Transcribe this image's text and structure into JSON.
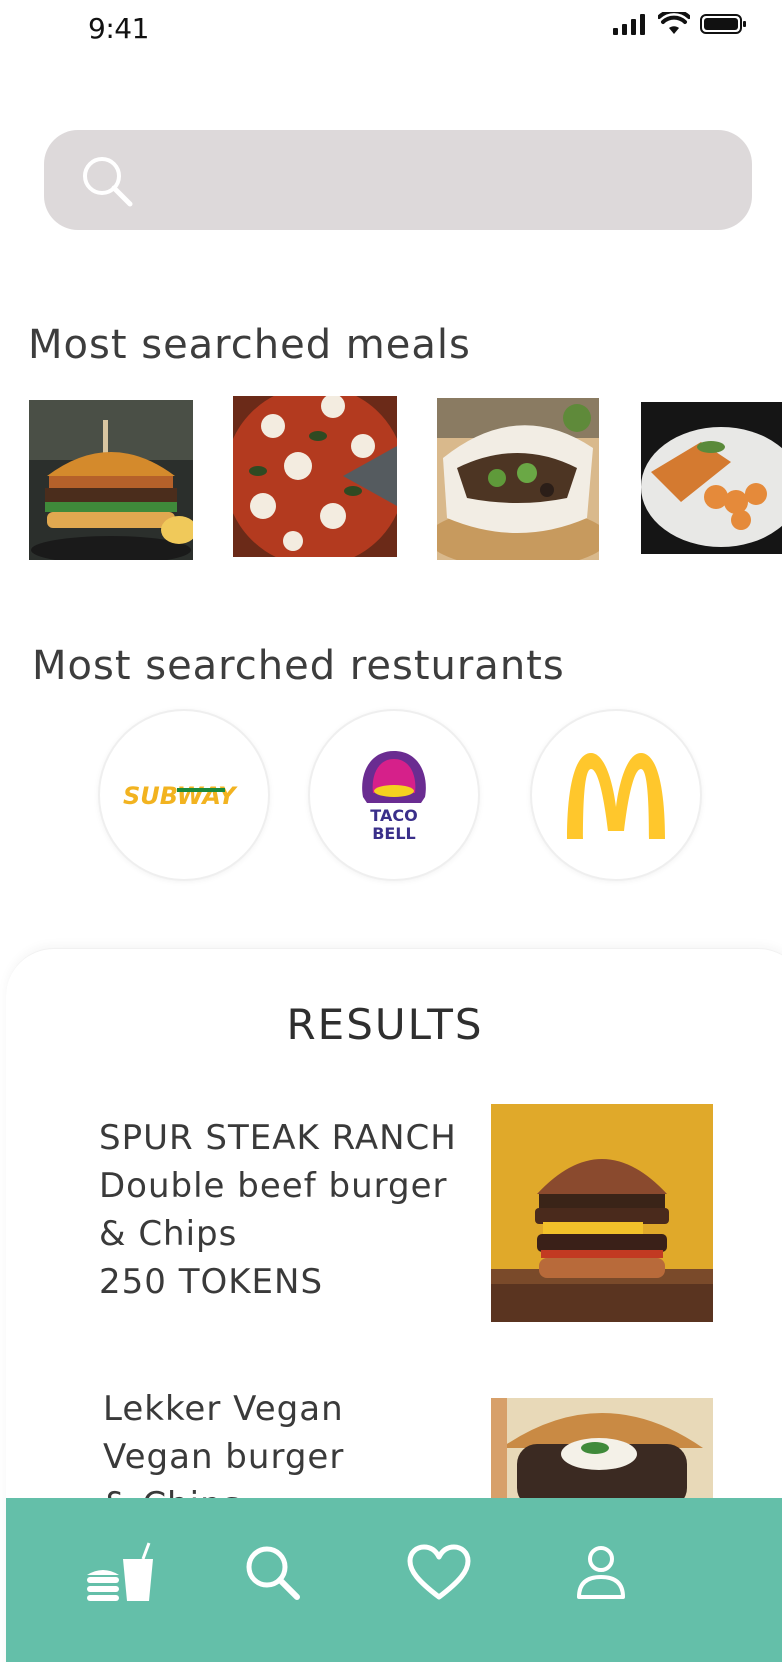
{
  "status_bar": {
    "time": "9:41"
  },
  "search": {
    "placeholder": "",
    "value": ""
  },
  "meals_section": {
    "title": "Most searched meals",
    "items": [
      "burger",
      "pizza",
      "bao bun",
      "shrimp skewers"
    ]
  },
  "restaurants_section": {
    "title": "Most searched resturants",
    "items": [
      {
        "name": "Subway",
        "logo_text": "SUBWAY"
      },
      {
        "name": "Taco Bell",
        "logo_text_line1": "TACO",
        "logo_text_line2": "BELL"
      },
      {
        "name": "McDonald's"
      }
    ]
  },
  "results": {
    "title": "RESULTS",
    "items": [
      {
        "restaurant": "SPUR STEAK RANCH",
        "dish_line1": "Double beef burger",
        "dish_line2": "& Chips",
        "price": "250 TOKENS"
      },
      {
        "restaurant": "Lekker Vegan",
        "dish_line1": "Vegan burger",
        "dish_line2": "& Chips"
      }
    ]
  },
  "bottom_nav": {
    "items": [
      "meals-icon",
      "search-icon",
      "heart-icon",
      "profile-icon"
    ],
    "background": "#64bfa9"
  },
  "colors": {
    "search_bg": "#ddd9da",
    "accent": "#64bfa9"
  }
}
